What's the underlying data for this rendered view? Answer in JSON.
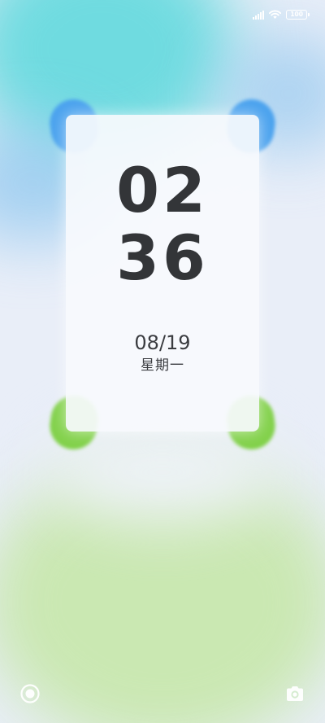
{
  "status_bar": {
    "battery_level": "100",
    "signal_icon": "cellular-signal-icon",
    "wifi_icon": "wifi-icon"
  },
  "lockscreen": {
    "hours": "02",
    "minutes": "36",
    "date": "08/19",
    "weekday": "星期一"
  },
  "shortcuts": {
    "left_icon": "assistant-circle-icon",
    "right_icon": "camera-icon"
  },
  "colors": {
    "corner_top": "#4aa2ee",
    "corner_bottom": "#82d14a",
    "clock_text": "#333538"
  }
}
